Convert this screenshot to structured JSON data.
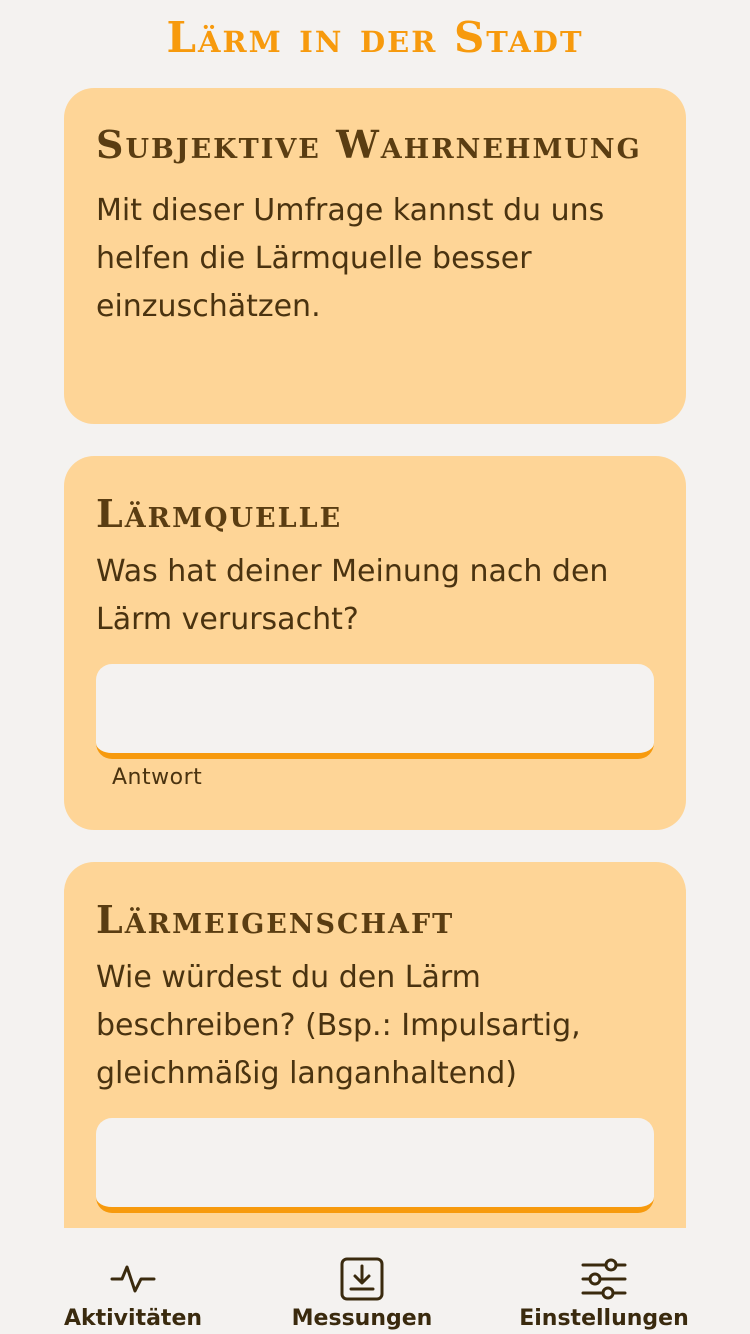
{
  "header": {
    "title": "Lärm in der Stadt"
  },
  "cards": {
    "intro": {
      "title": "Subjektive Wahrnehmung",
      "text": "Mit dieser Umfrage kannst du uns helfen die Lärmquelle besser einzuschätzen."
    },
    "source": {
      "title": "Lärmquelle",
      "question": "Was hat deiner Meinung nach den Lärm verursacht?",
      "input_value": "",
      "helper": "Antwort"
    },
    "property": {
      "title": "Lärmeigenschaft",
      "question": "Wie würdest du den Lärm beschreiben? (Bsp.: Impulsartig, gleichmäßig langanhaltend)",
      "input_value": ""
    }
  },
  "bottom_nav": {
    "items": [
      {
        "label": "Aktivitäten",
        "icon": "activity-icon"
      },
      {
        "label": "Messungen",
        "icon": "download-box-icon"
      },
      {
        "label": "Einstellungen",
        "icon": "sliders-icon"
      }
    ]
  },
  "colors": {
    "accent": "#f79a0d",
    "card_bg": "#fed597",
    "page_bg": "#f4f2f0",
    "text_dark": "#5a3d12"
  }
}
